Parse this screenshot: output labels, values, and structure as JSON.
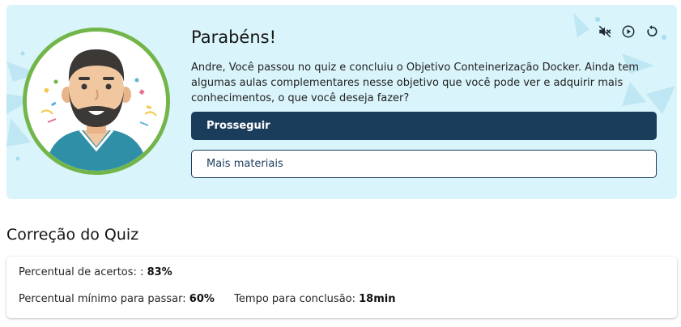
{
  "banner": {
    "title": "Parabéns!",
    "message": "Andre, Você passou no quiz e concluiu o Objetivo Conteinerização Docker. Ainda tem algumas aulas complementares nesse objetivo que você pode ver e adquirir mais conhecimentos, o que você deseja fazer?",
    "primary_button": "Prosseguir",
    "secondary_button": "Mais materiais",
    "controls": [
      "volume-muted-icon",
      "play-circle-icon",
      "replay-icon"
    ],
    "colors": {
      "background": "#d9f4fb",
      "ring": "#72b548",
      "primary": "#1b3d5c"
    }
  },
  "quiz": {
    "section_title": "Correção do Quiz",
    "score_label": "Percentual de acertos: :",
    "score_value": "83%",
    "min_label": "Percentual mínimo para passar:",
    "min_value": "60%",
    "time_label": "Tempo para conclusão:",
    "time_value": "18min"
  }
}
